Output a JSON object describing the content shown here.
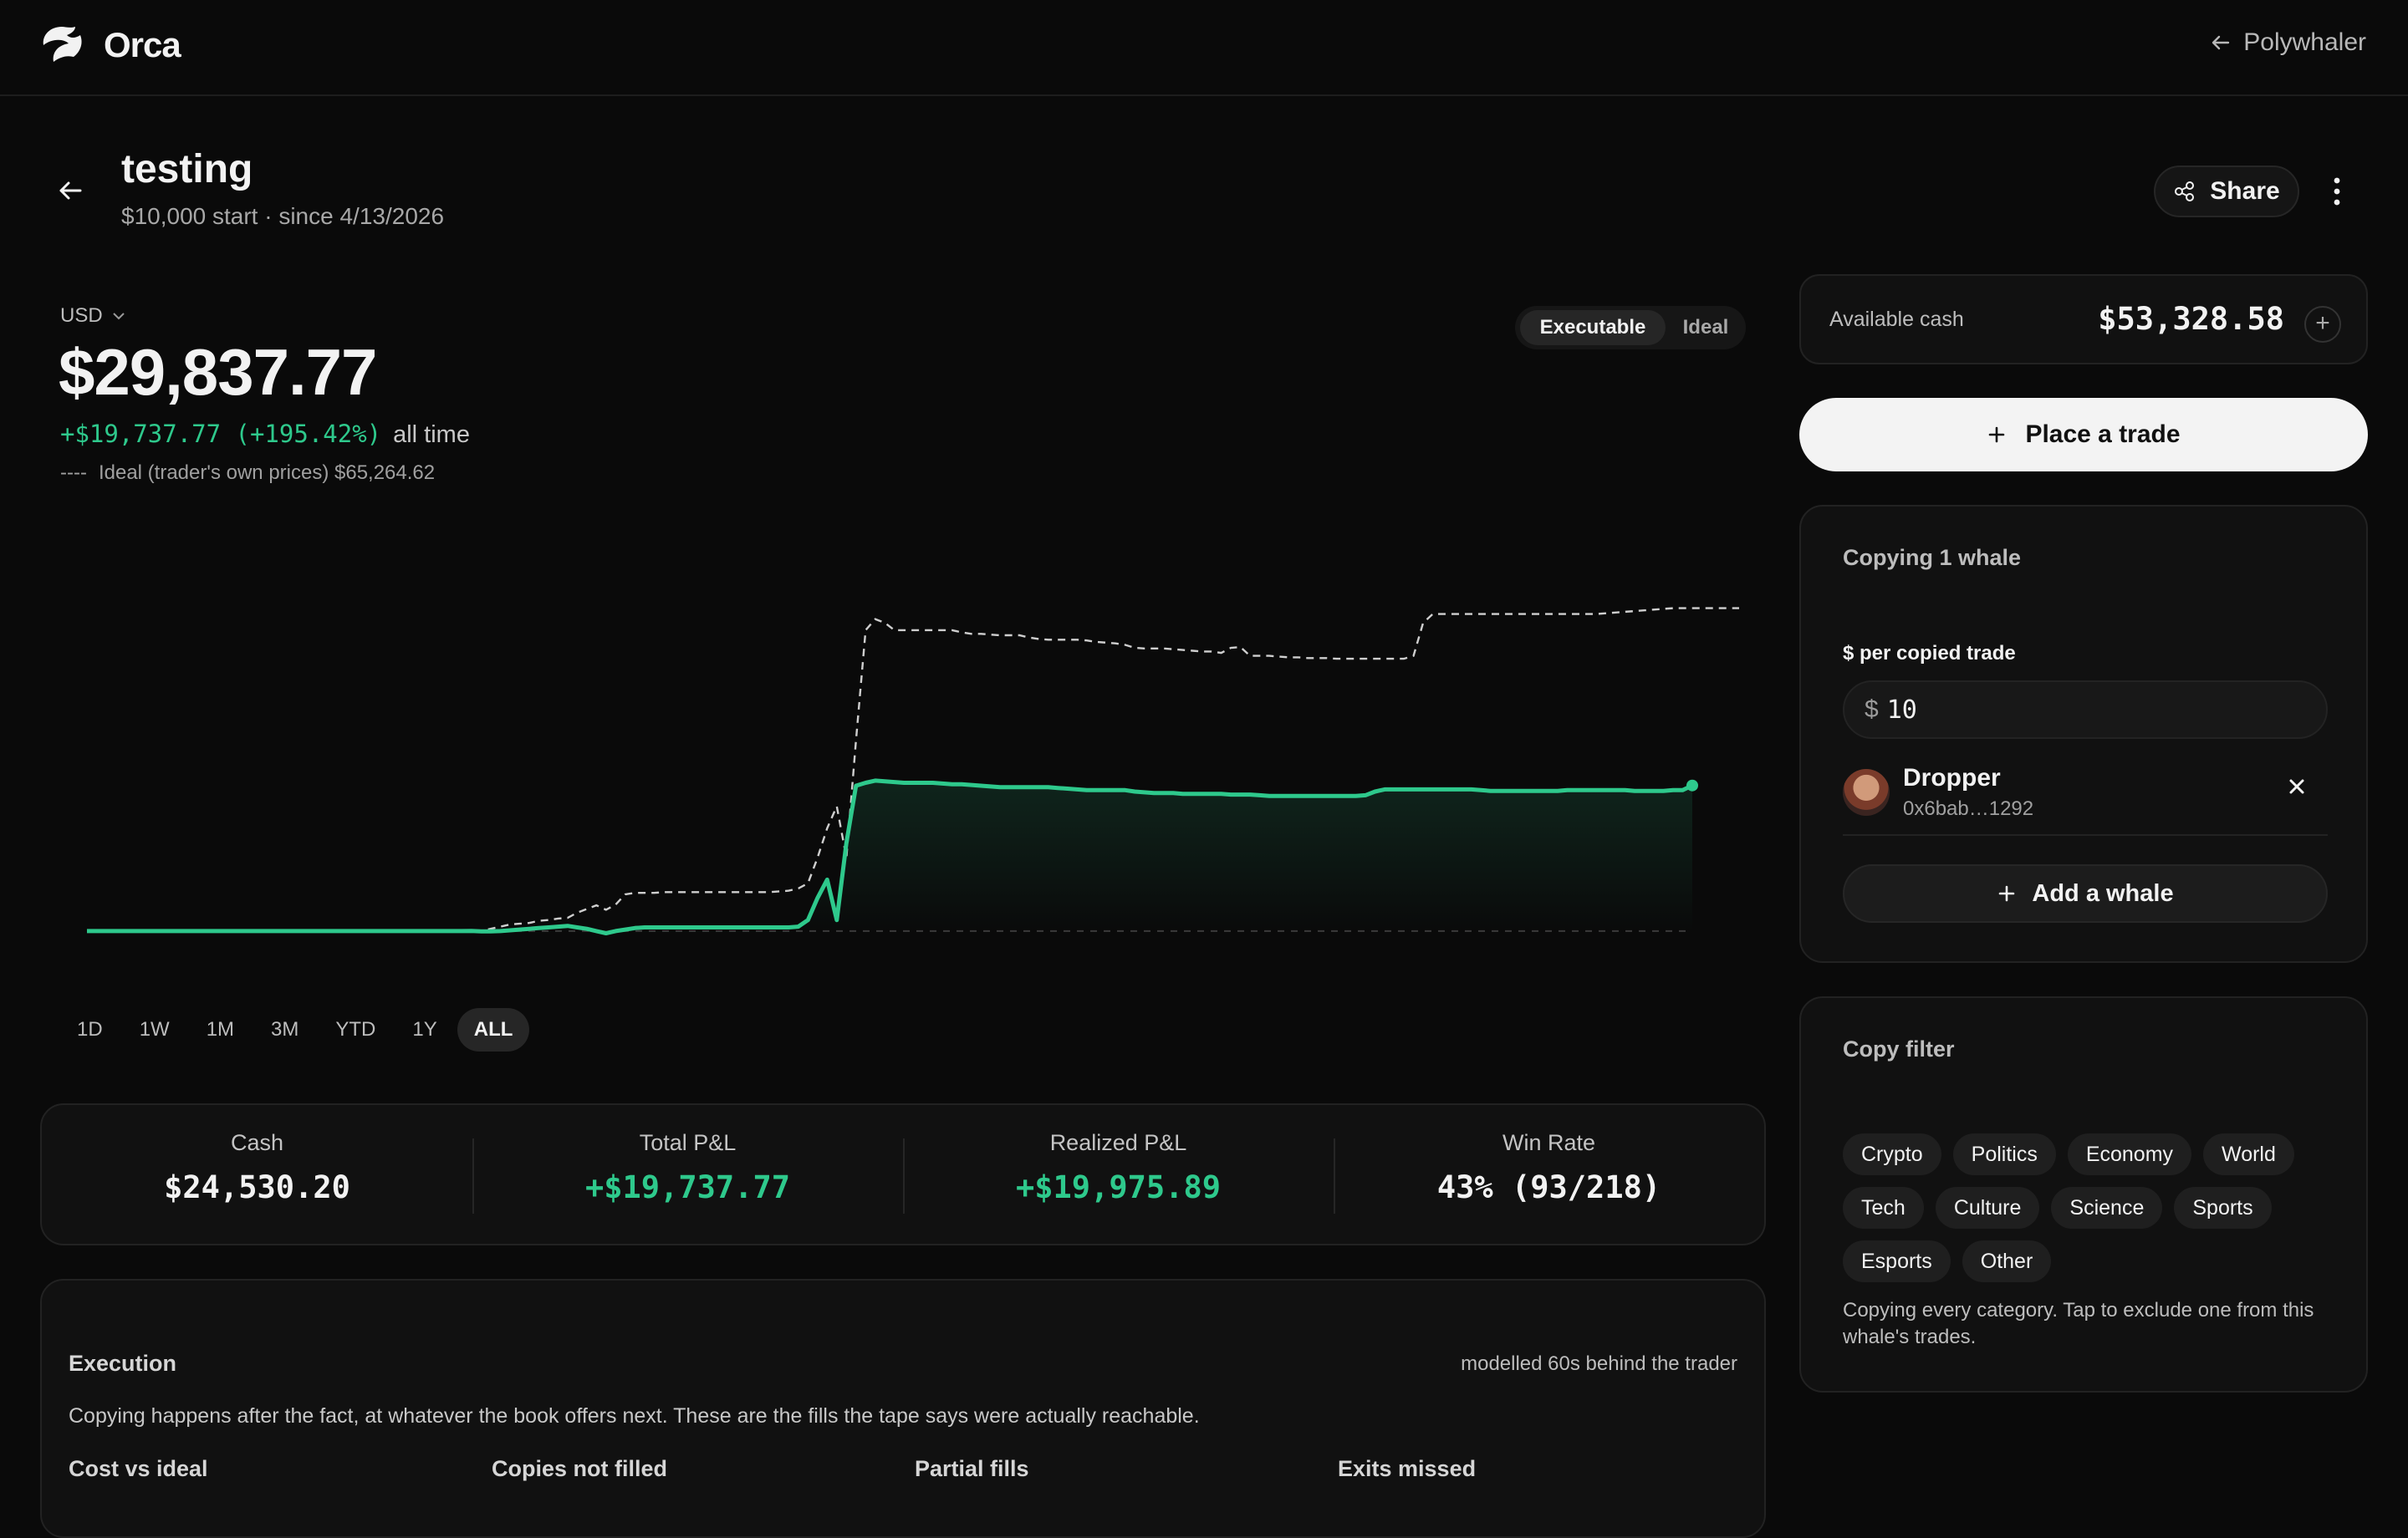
{
  "app": {
    "name": "Orca",
    "back_link": "Polywhaler"
  },
  "header": {
    "title": "testing",
    "subtitle": "$10,000 start · since 4/13/2026",
    "share_label": "Share"
  },
  "portfolio": {
    "currency": "USD",
    "value": "$29,837.77",
    "pnl": "+$19,737.77 (+195.42%)",
    "pnl_period": "all time",
    "ideal_legend": "----",
    "ideal_text": "Ideal (trader's own prices) $65,264.62",
    "toggle": {
      "active": "Executable",
      "inactive": "Ideal"
    }
  },
  "chart_data": {
    "type": "line",
    "title": "",
    "xlabel": "",
    "ylabel": "",
    "grid": false,
    "baseline": 10000,
    "series": [
      {
        "style": "solid-green-area",
        "color": "#2ec98c",
        "values": [
          10000,
          10000,
          10000,
          10000,
          10000,
          10000,
          10000,
          10000,
          10000,
          10000,
          10000,
          10000,
          10000,
          10000,
          10000,
          10000,
          10000,
          10000,
          10000,
          10000,
          10000,
          10000,
          10000,
          10000,
          10000,
          10000,
          10000,
          10000,
          10000,
          10000,
          10000,
          10000,
          10000,
          10000,
          10000,
          10000,
          10000,
          10000,
          10000,
          10000,
          10020,
          9960,
          9950,
          10000,
          10100,
          10200,
          10300,
          10400,
          10500,
          10600,
          10700,
          10500,
          10300,
          10000,
          9700,
          10000,
          10200,
          10400,
          10500,
          10500,
          10500,
          10500,
          10500,
          10500,
          10500,
          10500,
          10500,
          10500,
          10500,
          10500,
          10500,
          10500,
          10500,
          10500,
          10600,
          11500,
          14500,
          17000,
          11500,
          22000,
          29800,
          30200,
          30500,
          30400,
          30300,
          30200,
          30200,
          30200,
          30200,
          30100,
          30000,
          30000,
          29900,
          29800,
          29700,
          29600,
          29600,
          29600,
          29600,
          29600,
          29600,
          29500,
          29400,
          29300,
          29200,
          29200,
          29200,
          29200,
          29200,
          29000,
          28900,
          28800,
          28800,
          28800,
          28700,
          28700,
          28700,
          28700,
          28700,
          28600,
          28600,
          28600,
          28500,
          28400,
          28400,
          28400,
          28400,
          28400,
          28400,
          28400,
          28400,
          28400,
          28400,
          28500,
          29000,
          29300,
          29300,
          29300,
          29300,
          29300,
          29300,
          29300,
          29300,
          29300,
          29300,
          29200,
          29100,
          29100,
          29100,
          29100,
          29100,
          29100,
          29100,
          29100,
          29200,
          29200,
          29200,
          29200,
          29200,
          29200,
          29200,
          29100,
          29100,
          29100,
          29100,
          29200,
          29200,
          29837
        ]
      },
      {
        "style": "dashed-gray",
        "color": "#cfcfcf",
        "values": [
          10000,
          10000,
          10000,
          10000,
          10000,
          10000,
          10000,
          10000,
          10000,
          10000,
          10000,
          10000,
          10000,
          10000,
          10000,
          10000,
          10000,
          10000,
          10000,
          10000,
          10000,
          10000,
          10000,
          10000,
          10000,
          10000,
          10000,
          10000,
          10000,
          10000,
          10000,
          10000,
          10000,
          10000,
          10000,
          10000,
          10000,
          10000,
          10000,
          10000,
          10100,
          10000,
          10300,
          10600,
          10900,
          11000,
          11100,
          11400,
          11500,
          11700,
          11800,
          12500,
          13000,
          13500,
          12900,
          13600,
          15000,
          15200,
          15200,
          15200,
          15300,
          15300,
          15300,
          15300,
          15300,
          15300,
          15300,
          15300,
          15300,
          15300,
          15300,
          15300,
          15400,
          15500,
          15800,
          16500,
          20000,
          24000,
          27000,
          20000,
          36000,
          51000,
          52500,
          52000,
          51000,
          51000,
          51000,
          51000,
          51000,
          51000,
          51000,
          50700,
          50500,
          50500,
          50400,
          50300,
          50300,
          50300,
          50000,
          49800,
          49700,
          49700,
          49700,
          49700,
          49600,
          49400,
          49300,
          49200,
          49000,
          48600,
          48500,
          48500,
          48500,
          48400,
          48300,
          48200,
          48100,
          48100,
          47900,
          48600,
          48700,
          47500,
          47500,
          47500,
          47400,
          47300,
          47300,
          47200,
          47200,
          47200,
          47100,
          47100,
          47100,
          47100,
          47100,
          47100,
          47100,
          47100,
          47500,
          52000,
          53200,
          53200,
          53200,
          53200,
          53200,
          53200,
          53200,
          53200,
          53200,
          53200,
          53200,
          53200,
          53200,
          53200,
          53200,
          53200,
          53200,
          53200,
          53300,
          53400,
          53500,
          53600,
          53700,
          53800,
          53900,
          54000,
          54000,
          54000,
          54000,
          54000,
          54000,
          54000,
          54000,
          54000,
          54000,
          54000,
          54000,
          54000
        ]
      }
    ]
  },
  "ranges": [
    "1D",
    "1W",
    "1M",
    "3M",
    "YTD",
    "1Y",
    "ALL"
  ],
  "active_range": "ALL",
  "stats": [
    {
      "label": "Cash",
      "value": "$24,530.20"
    },
    {
      "label": "Total P&L",
      "value": "+$19,737.77"
    },
    {
      "label": "Realized P&L",
      "value": "+$19,975.89"
    },
    {
      "label": "Win Rate",
      "value": "43% (93/218)"
    }
  ],
  "execution": {
    "title": "Execution",
    "note": "modelled 60s behind the trader",
    "description": "Copying happens after the fact, at whatever the book offers next. These are the fills the tape says were actually reachable.",
    "columns": [
      "Cost vs ideal",
      "Copies not filled",
      "Partial fills",
      "Exits missed"
    ]
  },
  "sidebar": {
    "available_cash_label": "Available cash",
    "available_cash": "$53,328.58",
    "place_trade_label": "Place a trade",
    "copying_title": "Copying 1 whale",
    "per_trade_label": "$ per copied trade",
    "per_trade_symbol": "$",
    "per_trade_value": "10",
    "whale": {
      "name": "Dropper",
      "address": "0x6bab…1292"
    },
    "add_whale_label": "Add a whale",
    "filter_title": "Copy filter",
    "categories": [
      "Crypto",
      "Politics",
      "Economy",
      "World",
      "Tech",
      "Culture",
      "Science",
      "Sports",
      "Esports",
      "Other"
    ],
    "filter_note": "Copying every category. Tap to exclude one from this whale's trades."
  },
  "colors": {
    "gain": "#2ec98c",
    "loss": "#e5484d",
    "background": "#0a0a0a"
  }
}
